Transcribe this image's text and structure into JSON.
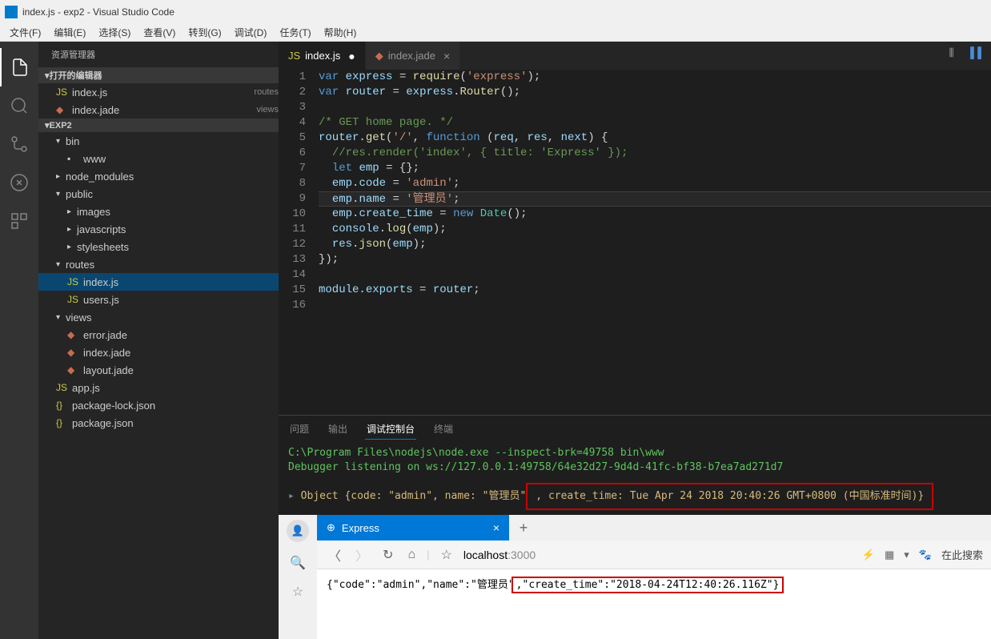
{
  "titlebar": "index.js - exp2 - Visual Studio Code",
  "menu": {
    "file": "文件(F)",
    "edit": "编辑(E)",
    "select": "选择(S)",
    "view": "查看(V)",
    "goto": "转到(G)",
    "debug": "调试(D)",
    "tasks": "任务(T)",
    "help": "帮助(H)"
  },
  "sidebar": {
    "title": "资源管理器",
    "openEditors": "打开的编辑器",
    "openEditorsItems": [
      {
        "icon": "JS",
        "name": "index.js",
        "desc": "routes"
      },
      {
        "icon": "jade",
        "name": "index.jade",
        "desc": "views"
      }
    ],
    "workspace": "EXP2",
    "tree": [
      {
        "type": "folder",
        "name": "bin",
        "depth": 1,
        "open": true
      },
      {
        "type": "file",
        "name": "www",
        "depth": 2,
        "icon": ""
      },
      {
        "type": "folder",
        "name": "node_modules",
        "depth": 1,
        "open": false
      },
      {
        "type": "folder",
        "name": "public",
        "depth": 1,
        "open": true
      },
      {
        "type": "folder",
        "name": "images",
        "depth": 2,
        "open": false
      },
      {
        "type": "folder",
        "name": "javascripts",
        "depth": 2,
        "open": false
      },
      {
        "type": "folder",
        "name": "stylesheets",
        "depth": 2,
        "open": false
      },
      {
        "type": "folder",
        "name": "routes",
        "depth": 1,
        "open": true
      },
      {
        "type": "file",
        "name": "index.js",
        "depth": 2,
        "icon": "JS",
        "selected": true
      },
      {
        "type": "file",
        "name": "users.js",
        "depth": 2,
        "icon": "JS"
      },
      {
        "type": "folder",
        "name": "views",
        "depth": 1,
        "open": true
      },
      {
        "type": "file",
        "name": "error.jade",
        "depth": 2,
        "icon": "jade"
      },
      {
        "type": "file",
        "name": "index.jade",
        "depth": 2,
        "icon": "jade"
      },
      {
        "type": "file",
        "name": "layout.jade",
        "depth": 2,
        "icon": "jade"
      },
      {
        "type": "file",
        "name": "app.js",
        "depth": 1,
        "icon": "JS"
      },
      {
        "type": "file",
        "name": "package-lock.json",
        "depth": 1,
        "icon": "{}"
      },
      {
        "type": "file",
        "name": "package.json",
        "depth": 1,
        "icon": "{}"
      }
    ]
  },
  "tabs": [
    {
      "icon": "JS",
      "name": "index.js",
      "active": true,
      "dirty": true
    },
    {
      "icon": "jade",
      "name": "index.jade",
      "active": false,
      "dirty": false
    }
  ],
  "code": {
    "lines": [
      {
        "n": 1,
        "html": "<span class='k-blue'>var</span> <span class='k-var'>express</span> <span class='k-white'>=</span> <span class='k-yellow'>require</span><span class='k-white'>(</span><span class='k-string'>'express'</span><span class='k-white'>);</span>"
      },
      {
        "n": 2,
        "html": "<span class='k-blue'>var</span> <span class='k-var'>router</span> <span class='k-white'>=</span> <span class='k-var'>express</span><span class='k-white'>.</span><span class='k-yellow'>Router</span><span class='k-white'>();</span>"
      },
      {
        "n": 3,
        "html": ""
      },
      {
        "n": 4,
        "html": "<span class='k-comment'>/* GET home page. */</span>"
      },
      {
        "n": 5,
        "html": "<span class='k-var'>router</span><span class='k-white'>.</span><span class='k-yellow'>get</span><span class='k-white'>(</span><span class='k-string'>'/'</span><span class='k-white'>, </span><span class='k-blue'>function</span> <span class='k-white'>(</span><span class='k-var'>req</span><span class='k-white'>, </span><span class='k-var'>res</span><span class='k-white'>, </span><span class='k-var'>next</span><span class='k-white'>) {</span>"
      },
      {
        "n": 6,
        "html": "  <span class='k-comment'>//res.render('index', { title: 'Express' });</span>"
      },
      {
        "n": 7,
        "html": "  <span class='k-blue'>let</span> <span class='k-var'>emp</span> <span class='k-white'>= {};</span>"
      },
      {
        "n": 8,
        "html": "  <span class='k-var'>emp</span><span class='k-white'>.</span><span class='k-var'>code</span> <span class='k-white'>=</span> <span class='k-string'>'admin'</span><span class='k-white'>;</span>"
      },
      {
        "n": 9,
        "html": "  <span class='k-var'>emp</span><span class='k-white'>.</span><span class='k-var'>name</span> <span class='k-white'>=</span> <span class='k-string'>'管理员'</span><span class='k-white'>;</span>",
        "current": true
      },
      {
        "n": 10,
        "html": "  <span class='k-var'>emp</span><span class='k-white'>.</span><span class='k-var'>create_time</span> <span class='k-white'>=</span> <span class='k-blue'>new</span> <span class='k-class'>Date</span><span class='k-white'>();</span>"
      },
      {
        "n": 11,
        "html": "  <span class='k-var'>console</span><span class='k-white'>.</span><span class='k-yellow'>log</span><span class='k-white'>(</span><span class='k-var'>emp</span><span class='k-white'>);</span>"
      },
      {
        "n": 12,
        "html": "  <span class='k-var'>res</span><span class='k-white'>.</span><span class='k-yellow'>json</span><span class='k-white'>(</span><span class='k-var'>emp</span><span class='k-white'>);</span>"
      },
      {
        "n": 13,
        "html": "<span class='k-white'>});</span>"
      },
      {
        "n": 14,
        "html": ""
      },
      {
        "n": 15,
        "html": "<span class='k-var'>module</span><span class='k-white'>.</span><span class='k-var'>exports</span> <span class='k-white'>=</span> <span class='k-var'>router</span><span class='k-white'>;</span>"
      },
      {
        "n": 16,
        "html": ""
      }
    ]
  },
  "panel": {
    "tabs": {
      "problems": "问题",
      "output": "输出",
      "debug": "调试控制台",
      "terminal": "终端"
    },
    "line1": "C:\\Program Files\\nodejs\\node.exe --inspect-brk=49758 bin\\www",
    "line2": "Debugger listening on ws://127.0.0.1:49758/64e32d27-9d4d-41fc-bf38-b7ea7ad271d7",
    "object_prefix": "Object {code: \"admin\", name: \"管理员\"",
    "object_highlight": ", create_time: Tue Apr 24 2018 20:40:26 GMT+0800 (中国标准时间)}"
  },
  "browser": {
    "tabTitle": "Express",
    "urlHost": "localhost",
    "urlPath": ":3000",
    "search": "在此搜索",
    "body_prefix": "{\"code\":\"admin\",\"name\":\"管理员\"",
    "body_highlight": ",\"create_time\":\"2018-04-24T12:40:26.116Z\"}"
  }
}
